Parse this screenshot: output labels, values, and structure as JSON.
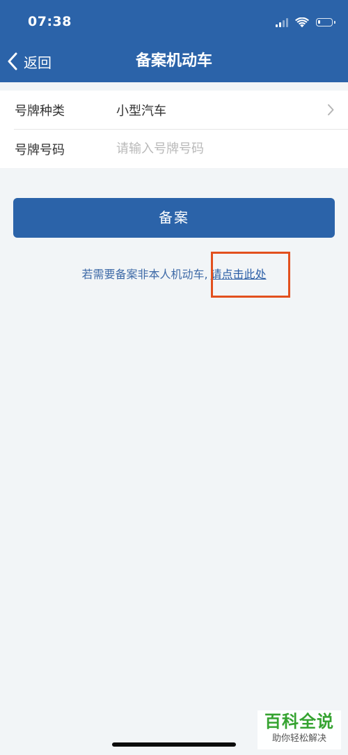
{
  "status_bar": {
    "time": "07:38",
    "signal_icon": "cellular-signal-icon",
    "wifi_icon": "wifi-icon",
    "battery_icon": "battery-icon",
    "battery_level": 0.15
  },
  "nav": {
    "back_icon": "chevron-left-icon",
    "back_label": "返回",
    "title": "备案机动车"
  },
  "form": {
    "plate_type": {
      "label": "号牌种类",
      "value": "小型汽车",
      "arrow_icon": "chevron-right-icon"
    },
    "plate_number": {
      "label": "号牌号码",
      "value": "",
      "placeholder": "请输入号牌号码"
    }
  },
  "actions": {
    "submit_label": "备案"
  },
  "helper": {
    "text": "若需要备案非本人机动车,",
    "link_label": "请点击此处"
  },
  "annotation": {
    "highlight_color": "#e2501e"
  },
  "watermark": {
    "title": "百科全说",
    "subtitle": "助你轻松解决"
  },
  "colors": {
    "brand": "#2b63a9",
    "background": "#f2f5f7",
    "watermark_green": "#35a330"
  }
}
